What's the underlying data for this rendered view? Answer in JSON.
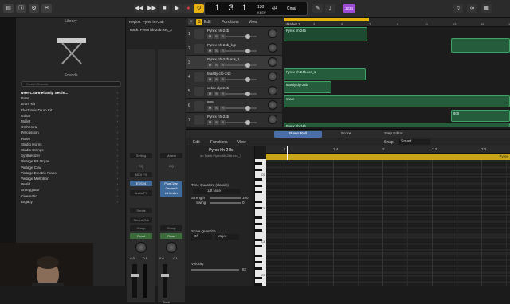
{
  "colors": {
    "accent": "#f5c518",
    "region": "#245c3c",
    "region_border": "#3fa365",
    "record": "#d63b3b",
    "transport_green": "#3a7a3a"
  },
  "toolbar": {
    "lcd": {
      "bar": "1",
      "beat": "3",
      "div": "1",
      "tempo": "130",
      "tempo_label": "KEEP",
      "sig_top": "4/4",
      "key": "Cmaj",
      "bar_label": "BAR",
      "beat_label": "BEAT",
      "tempo_sub": "KEEP"
    },
    "cpu_badge": "1234",
    "icons": [
      "library-icon",
      "info-icon",
      "settings-icon",
      "scissors-icon",
      "rewind-icon",
      "fastforward-icon",
      "stop-icon",
      "play-icon",
      "record-icon",
      "cycle-icon",
      "pencil-icon",
      "metronome-icon",
      "smart-controls-icon",
      "note-icon",
      "loop-icon",
      "media-icon"
    ]
  },
  "library": {
    "title": "Library",
    "sounds_title": "Sounds",
    "search_placeholder": "Search Sounds",
    "items": [
      "User Channel Strip Settin...",
      "Bass",
      "Drum Kit",
      "Electronic Drum Kit",
      "Guitar",
      "Mallet",
      "Orchestral",
      "Percussion",
      "Piano",
      "Studio Horns",
      "Studio Strings",
      "Synthesizer",
      "Vintage B3 Organ",
      "Vintage Clav",
      "Vintage Electric Piano",
      "Vintage Mellotron",
      "World",
      "Arpeggiator",
      "Cinematic",
      "Legacy"
    ]
  },
  "inspector": {
    "region_label": "Region: Pyrex hh-24b",
    "track_label": "Track: Pyrex hh-24b.exs_3",
    "strip1": {
      "setting": "Setting",
      "eq": "EQ",
      "midi_fx": "MIDI FX",
      "instrument": "EXS24",
      "audio_fx": "Audio FX",
      "sends": "Sends",
      "stereo_out": "Stereo Out",
      "group": "Group",
      "read": "Read",
      "pan": "-6.0",
      "vol": "-0.1",
      "name": "Pyrex hh-24b"
    },
    "strip2": {
      "setting": "Master",
      "eq": "EQ",
      "audio_fx": "PlugChan\nOzone 8\nL1 limiter",
      "group": "Group",
      "read": "Read",
      "pan": "0.0",
      "vol": "-0.1",
      "name": "Stereo Out",
      "bnce": "Bnce"
    }
  },
  "tracks": {
    "header": {
      "edit": "Edit",
      "functions": "Functions",
      "view": "View"
    },
    "rows": [
      {
        "num": "1",
        "name": "Pyrex hh-24b"
      },
      {
        "num": "2",
        "name": "Pyrex hh-24b_lop"
      },
      {
        "num": "3",
        "name": "Pyrex hh-24b.exs_1"
      },
      {
        "num": "4",
        "name": "Mastly clp-24b"
      },
      {
        "num": "5",
        "name": "velox clp-24b"
      },
      {
        "num": "6",
        "name": "808"
      },
      {
        "num": "7",
        "name": "Pyrex hh-24b"
      }
    ],
    "msr": [
      "M",
      "S",
      "R"
    ]
  },
  "arrange": {
    "ruler_marks": [
      "1",
      "3",
      "5",
      "7",
      "9",
      "11",
      "13",
      "15",
      "17"
    ],
    "marker": "Marker 1",
    "regions": [
      {
        "label": "Pyrex hh-24b"
      },
      {
        "label": "Pyrex hh-24b.exs_1"
      },
      {
        "label": "Mastly clp-24b"
      },
      {
        "label": "snare"
      },
      {
        "label": "808"
      },
      {
        "label": "Pyrex hh-24b"
      }
    ]
  },
  "editor": {
    "tabs": [
      "Piano Roll",
      "Score",
      "Step Editor"
    ],
    "bar": {
      "edit": "Edit",
      "functions": "Functions",
      "view": "View",
      "snap_label": "Snap:",
      "snap_value": "Smart"
    },
    "ruler": [
      "1.3",
      "1.4",
      "2",
      "2.2",
      "2.3"
    ],
    "region_name": "Pyrex hh-24b",
    "region_track": "on Track Pyrex hh-24b.exs_3",
    "time_quantize_label": "Time Quantize (classic)",
    "quantize_value": "1/8 Note",
    "strength_label": "Strength",
    "strength_value": "100",
    "swing_label": "Swing",
    "swing_value": "0",
    "scale_quantize_label": "Scale Quantize",
    "scale_off": "Off",
    "scale_major": "Major",
    "velocity_label": "Velocity",
    "velocity_value": "82",
    "octaves": [
      "C6",
      "C5",
      "C4",
      "C3"
    ],
    "edge_label": "Pyrex"
  }
}
